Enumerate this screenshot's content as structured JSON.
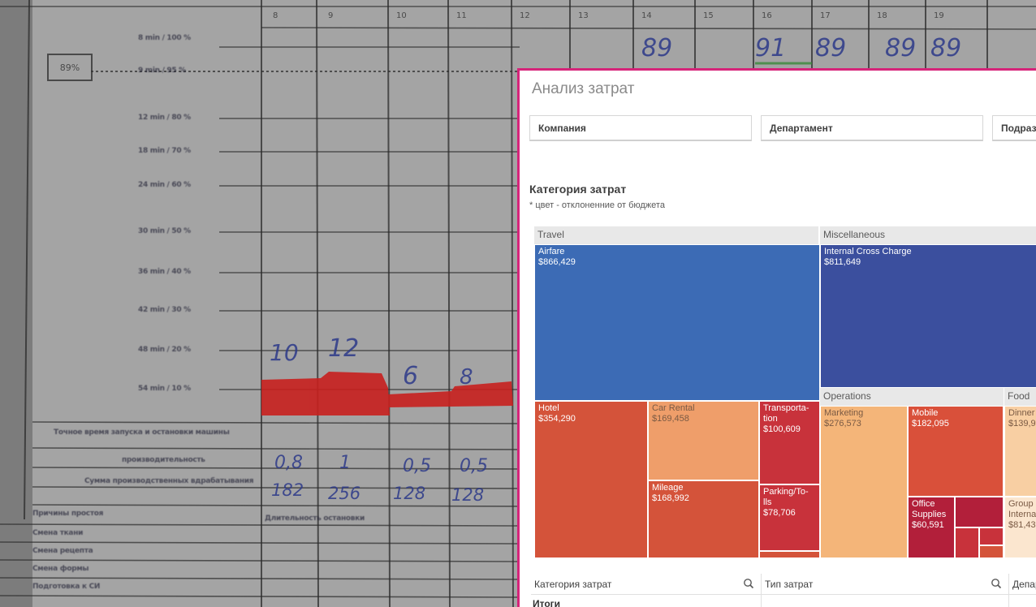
{
  "background": {
    "row_labels": [
      "8 min / 100 %",
      "9 min / 95 %",
      "12 min / 80 %",
      "18 min / 70 %",
      "24 min / 60 %",
      "30 min / 50 %",
      "36 min / 40 %",
      "42 min / 30 %",
      "48 min / 20 %",
      "54 min / 10 %",
      "Точное время запуска и остановки машины",
      "производительность",
      "Сумма производственных вдрабатывания",
      "Причины простоя",
      "Смена ткани",
      "Смена рецепта",
      "Смена формы",
      "Подготовка к СИ"
    ],
    "percent_box": "89%",
    "column_numbers": [
      "8",
      "9",
      "10",
      "11",
      "12",
      "13",
      "14",
      "15",
      "16",
      "17",
      "18",
      "19"
    ],
    "handwritten_top": [
      "89",
      "91",
      "89",
      "89",
      "89"
    ],
    "handwritten_mid": [
      "10",
      "12",
      "6",
      "8"
    ],
    "handwritten_rows": [
      "0,8",
      "1",
      "0,5",
      "0,5",
      "182",
      "256",
      "128",
      "128"
    ],
    "footer_text": "Длительность остановки"
  },
  "dashboard": {
    "title": "Анализ затрат",
    "filters": [
      "Компания",
      "Департамент",
      "Подразделение"
    ],
    "section_title": "Категория затрат",
    "section_subtitle": "* цвет - отклоненние от бюджета",
    "groups": {
      "travel": "Travel",
      "misc": "Miscellaneous",
      "operations": "Operations",
      "food": "Food"
    },
    "cells": {
      "airfare": {
        "name": "Airfare",
        "value": "$866,429"
      },
      "internal": {
        "name": "Internal Cross Charge",
        "value": "$811,649"
      },
      "hotel": {
        "name": "Hotel",
        "value": "$354,290"
      },
      "car_rental": {
        "name": "Car Rental",
        "value": "$169,458"
      },
      "transportation": {
        "name": "Transporta-tion",
        "value": "$100,609"
      },
      "mileage": {
        "name": "Mileage",
        "value": "$168,992"
      },
      "parking": {
        "name": "Parking/To-lls",
        "value": "$78,706"
      },
      "marketing": {
        "name": "Marketing",
        "value": "$276,573"
      },
      "mobile": {
        "name": "Mobile",
        "value": "$182,095"
      },
      "office": {
        "name": "Office Supplies",
        "value": "$60,591"
      },
      "dinner": {
        "name": "Dinner",
        "value": "$139,9"
      },
      "group": {
        "name": "Group I Interna",
        "value": "$81,43"
      }
    },
    "colors": {
      "airfare": "#3c6bb5",
      "internal": "#3b4f9e",
      "hotel": "#d4533a",
      "car_rental": "#ef9e6a",
      "transportation": "#c8323b",
      "mileage": "#d4533a",
      "parking": "#c8323b",
      "marketing": "#f4b579",
      "mobile": "#d9503a",
      "office": "#b21f3a",
      "dinner": "#f8cfa3",
      "group": "#fbe6cf",
      "accent": "#d6247a"
    },
    "table": {
      "columns": [
        "Категория затрат",
        "Тип затрат",
        "Департамент"
      ],
      "totals_label": "Итоги"
    }
  }
}
